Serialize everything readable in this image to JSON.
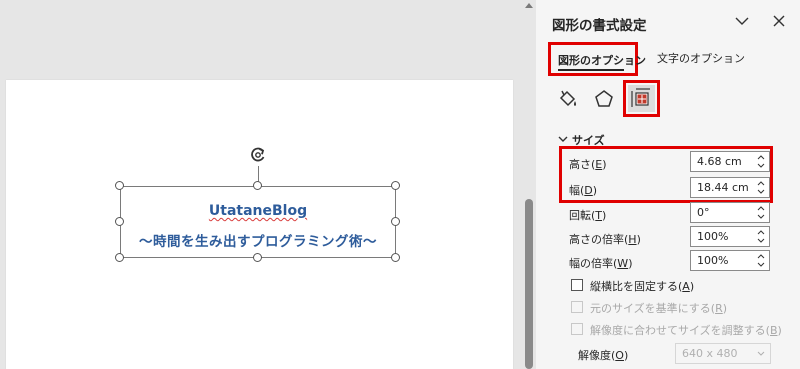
{
  "canvas": {
    "shape": {
      "line1": "UtataneBlog",
      "line2": "〜時間を生み出すプログラミング術〜"
    }
  },
  "pane": {
    "title": "図形の書式設定",
    "tabs": [
      {
        "label": "図形のオプション",
        "selected": true
      },
      {
        "label": "文字のオプション",
        "selected": false
      }
    ],
    "icons": [
      "fill-line-icon",
      "effects-icon",
      "size-properties-icon"
    ],
    "section": {
      "title": "サイズ",
      "fields": [
        {
          "label": "高さ",
          "key": "E",
          "value": "4.68 cm"
        },
        {
          "label": "幅",
          "key": "D",
          "value": "18.44 cm"
        },
        {
          "label": "回転",
          "key": "T",
          "value": "0°"
        },
        {
          "label": "高さの倍率",
          "key": "H",
          "value": "100%"
        },
        {
          "label": "幅の倍率",
          "key": "W",
          "value": "100%"
        }
      ],
      "checkboxes": [
        {
          "label": "縦横比を固定する",
          "key": "A",
          "enabled": true,
          "checked": false
        },
        {
          "label": "元のサイズを基準にする",
          "key": "R",
          "enabled": false,
          "checked": false
        },
        {
          "label": "解像度に合わせてサイズを調整する",
          "key": "B",
          "enabled": false,
          "checked": false
        }
      ],
      "resolution": {
        "label": "解像度",
        "key": "O",
        "value": "640 x 480"
      }
    }
  },
  "colors": {
    "highlight": "#e00000",
    "shape_text": "#2e5c9b",
    "pane_bg": "#f5f5f5"
  }
}
